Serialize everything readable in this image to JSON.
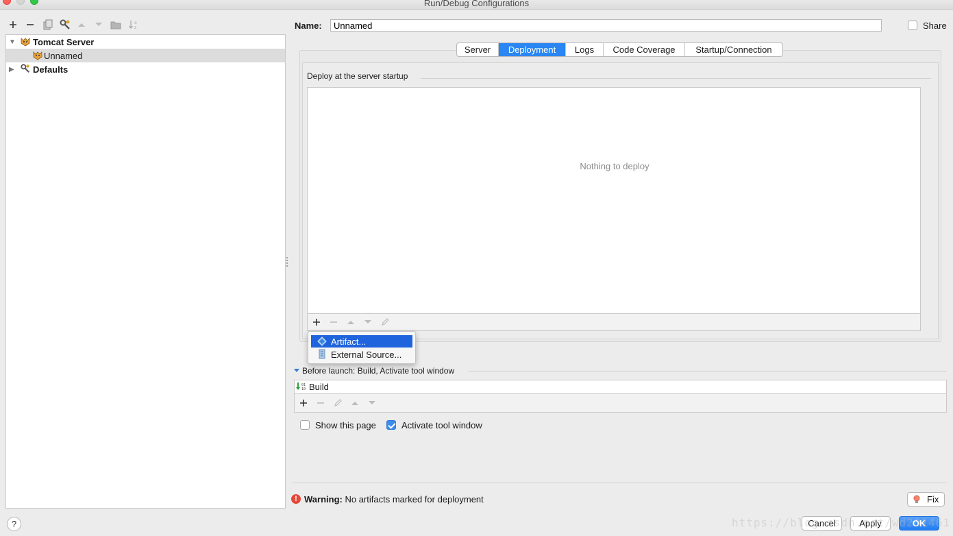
{
  "window": {
    "title": "Run/Debug Configurations"
  },
  "left_toolbar": {
    "icons": [
      "add-icon",
      "remove-icon",
      "copy-icon",
      "edit-defaults-icon",
      "move-up-icon",
      "move-down-icon",
      "folder-icon",
      "sort-icon"
    ]
  },
  "tree": {
    "items": [
      {
        "label": "Tomcat Server",
        "expanded": true,
        "bold": true,
        "icon": "tomcat-icon"
      },
      {
        "label": "Unnamed",
        "selected": true,
        "icon": "tomcat-icon"
      },
      {
        "label": "Defaults",
        "expanded": false,
        "bold": true,
        "icon": "wrench-icon"
      }
    ]
  },
  "name_field": {
    "label": "Name:",
    "value": "Unnamed"
  },
  "share": {
    "label": "Share",
    "checked": false
  },
  "tabs": [
    {
      "label": "Server",
      "active": false
    },
    {
      "label": "Deployment",
      "active": true
    },
    {
      "label": "Logs",
      "active": false
    },
    {
      "label": "Code Coverage",
      "active": false
    },
    {
      "label": "Startup/Connection",
      "active": false
    }
  ],
  "deployment": {
    "section_title": "Deploy at the server startup",
    "empty_text": "Nothing to deploy"
  },
  "popup_menu": {
    "items": [
      {
        "label": "Artifact...",
        "highlighted": true,
        "icon": "artifact-icon"
      },
      {
        "label": "External Source...",
        "highlighted": false,
        "icon": "external-source-icon"
      }
    ]
  },
  "before_launch": {
    "title": "Before launch: Build, Activate tool window",
    "items": [
      {
        "label": "Build",
        "icon": "build-icon"
      }
    ]
  },
  "options": {
    "show_this_page": {
      "label": "Show this page",
      "checked": false
    },
    "activate_tool_window": {
      "label": "Activate tool window",
      "checked": true
    }
  },
  "warning": {
    "prefix": "Warning:",
    "message": "No artifacts marked for deployment",
    "fix_label": "Fix"
  },
  "footer": {
    "help_label": "?",
    "cancel_label": "Cancel",
    "apply_label": "Apply",
    "ok_label": "OK"
  },
  "colors": {
    "accent": "#2a86f3",
    "selection": "#1f63dd",
    "error": "#e5493a",
    "window_bg": "#ececec"
  }
}
